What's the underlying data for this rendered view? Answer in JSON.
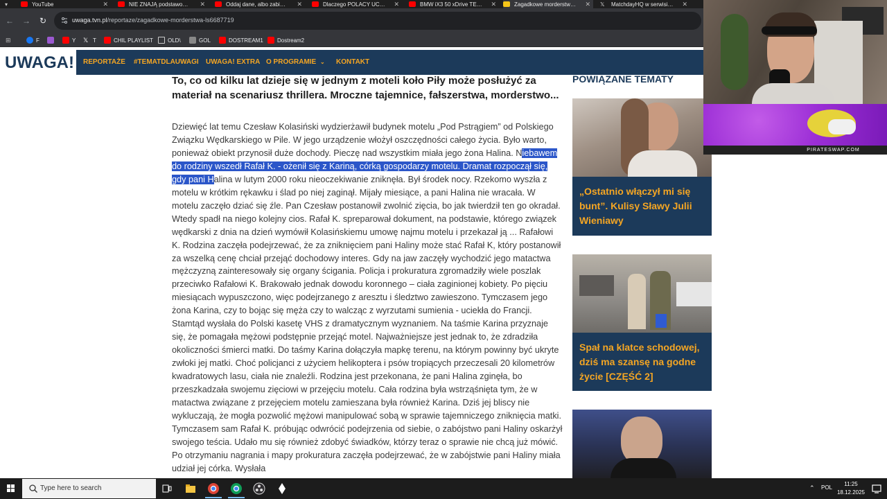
{
  "browser": {
    "tabs": [
      {
        "label": "YouTube",
        "color": "#ff0000"
      },
      {
        "label": "NIE ZNAJĄ podstawowy...",
        "color": "#ff0000"
      },
      {
        "label": "Oddaj dane, albo zabierał...",
        "color": "#ff0000"
      },
      {
        "label": "Dlaczego POLACY UCIEK...",
        "color": "#ff0000"
      },
      {
        "label": "BMW iX3 50 xDrive TEST...",
        "color": "#ff0000"
      },
      {
        "label": "Zagadkowe morderstwa...",
        "color": "#f5c518"
      },
      {
        "label": "MatchdayHQ w serwisie X",
        "color": "#cccccc"
      }
    ],
    "url_domain": "uwaga.tvn.pl",
    "url_path": "/reportaze/zagadkowe-morderstwa-ls6687719",
    "bookmarks": [
      {
        "label": "F",
        "color": "#1877f2"
      },
      {
        "label": "",
        "color": "#9b59d0"
      },
      {
        "label": "Y",
        "color": "#ff0000"
      },
      {
        "label": "T",
        "color": "#ffffff"
      },
      {
        "label": "CHIL PLAYLIST",
        "color": "#ff0000"
      },
      {
        "label": "OLD\\",
        "color": "#cccccc"
      },
      {
        "label": "GOL",
        "color": "#888888"
      },
      {
        "label": "DOSTREAM1",
        "color": "#ff0000"
      },
      {
        "label": "Dostream2",
        "color": "#ff0000"
      }
    ]
  },
  "site": {
    "logo": "UWAGA!",
    "nav": [
      "REPORTAŻE",
      "#TEMATDLAUWAGI",
      "UWAGA! EXTRA",
      "O PROGRAMIE",
      "KONTAKT"
    ],
    "accent": "#f5a623",
    "navy": "#1c3a5a"
  },
  "article": {
    "lead": "To, co od kilku lat dzieje się w jednym z moteli koło Piły może posłużyć za materiał na scenariusz thrillera. Mroczne tajemnice, fałszerstwa, morderstwo...",
    "body_before": "Dziewięć lat temu Czesław Kolasiński wydzierżawił budynek motelu „Pod Pstrągiem” od Polskiego Związku Wędkarskiego w Pile. W jego urządzenie włożył oszczędności całego życia. Było warto, ponieważ obiekt przynosił duże dochody. Pieczę nad wszystkim miała jego żona Halina. N",
    "body_selected": "iebawem do rodziny wszedł Rafał K. - ożenił się z Kariną, córką gospodarzy motelu. Dramat rozpoczął się, gdy pani H",
    "body_after": "alina w lutym 2000 roku nieoczekiwanie zniknęła. Był środek nocy. Rzekomo wyszła z motelu w krótkim rękawku i ślad po niej zaginął. Mijały miesiące, a pani Halina nie wracała. W motelu zaczęło dziać się źle. Pan Czesław postanowił zwolnić zięcia, bo jak twierdził ten go okradał. Wtedy spadł na niego kolejny cios. Rafał K. spreparował dokument, na podstawie, którego związek wędkarski z dnia na dzień wymówił Kolasińskiemu umowę najmu motelu i przekazał ją ... Rafałowi K. Rodzina zaczęła podejrzewać, że za zniknięciem pani Haliny może stać Rafał K, który postanowił za wszelką cenę chciał przejąć dochodowy interes. Gdy na jaw zaczęły wychodzić jego matactwa mężczyzną zainteresowały się organy ścigania. Policja i prokuratura zgromadziły wiele poszlak przeciwko Rafałowi K. Brakowało jednak dowodu koronnego – ciała zaginionej kobiety. Po pięciu miesiącach wypuszczono, więc podejrzanego z aresztu i śledztwo zawieszono. Tymczasem jego żona Karina, czy to bojąc się męża czy to walcząc z wyrzutami sumienia - uciekła do Francji. Stamtąd wysłała do Polski kasetę VHS z dramatycznym wyznaniem. Na taśmie Karina przyznaje się, że pomagała mężowi podstępnie przejąć motel. Najważniejsze jest jednak to, że zdradziła okoliczności śmierci matki. Do taśmy Karina dołączyła mapkę terenu, na którym powinny być ukryte zwłoki jej matki. Choć policjanci z użyciem helikoptera i psów tropiących przeczesali 20 kilometrów kwadratowych lasu, ciała nie znaleźli. Rodzina jest przekonana, że pani Halina zginęła, bo przeszkadzała swojemu zięciowi w przejęciu motelu. Cała rodzina była wstrząśnięta tym, że w matactwa związane z przejęciem motelu zamieszana była również Karina. Dziś jej bliscy nie wykluczają, że mogła pozwolić mężowi manipulować sobą w sprawie tajemniczego zniknięcia matki. Tymczasem sam Rafał K. próbując odwrócić podejrzenia od siebie, o zabójstwo pani Haliny oskarżył swojego teścia. Udało mu się również zdobyć świadków, którzy teraz o sprawie nie chcą już mówić. Po otrzymaniu nagrania i mapy prokuratura zaczęła podejrzewać, że w zabójstwie pani Haliny miała udział jej córka. Wysłała"
  },
  "sidebar": {
    "title": "POWIĄZANE TEMATY",
    "cards": [
      {
        "caption": "„Ostatnio włączył mi się bunt”. Kulisy Sławy Julii Wieniawy"
      },
      {
        "caption": "Spał na klatce schodowej, dziś ma szansę na godne życie [CZĘŚĆ 2]"
      },
      {
        "caption": ""
      }
    ]
  },
  "stream": {
    "overlay_brand": "PIRATESWAP.COM"
  },
  "taskbar": {
    "search_placeholder": "Type here to search",
    "language": "POL",
    "time": "11:25",
    "date": "18.12.2025"
  }
}
